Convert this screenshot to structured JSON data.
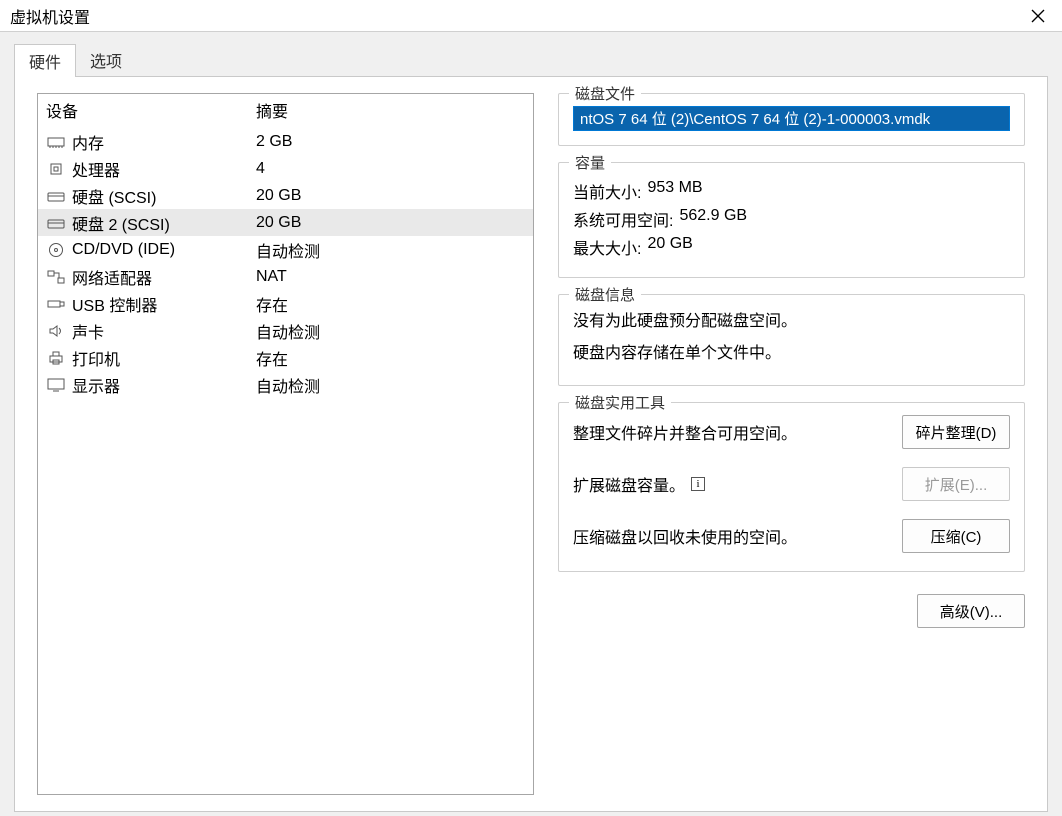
{
  "window": {
    "title": "虚拟机设置"
  },
  "tabs": {
    "hardware": "硬件",
    "options": "选项"
  },
  "device_table": {
    "header_device": "设备",
    "header_summary": "摘要",
    "rows": [
      {
        "icon": "memory-icon",
        "name": "内存",
        "summary": "2 GB"
      },
      {
        "icon": "cpu-icon",
        "name": "处理器",
        "summary": "4"
      },
      {
        "icon": "disk-icon",
        "name": "硬盘 (SCSI)",
        "summary": "20 GB"
      },
      {
        "icon": "disk-icon",
        "name": "硬盘 2 (SCSI)",
        "summary": "20 GB",
        "selected": true
      },
      {
        "icon": "cd-icon",
        "name": "CD/DVD (IDE)",
        "summary": "自动检测"
      },
      {
        "icon": "network-icon",
        "name": "网络适配器",
        "summary": "NAT"
      },
      {
        "icon": "usb-icon",
        "name": "USB 控制器",
        "summary": "存在"
      },
      {
        "icon": "audio-icon",
        "name": "声卡",
        "summary": "自动检测"
      },
      {
        "icon": "printer-icon",
        "name": "打印机",
        "summary": "存在"
      },
      {
        "icon": "display-icon",
        "name": "显示器",
        "summary": "自动检测"
      }
    ]
  },
  "disk_file": {
    "title": "磁盘文件",
    "value": "ntOS 7 64 位 (2)\\CentOS 7 64 位 (2)-1-000003.vmdk"
  },
  "capacity": {
    "title": "容量",
    "current_label": "当前大小:",
    "current_value": "953 MB",
    "free_label": "系统可用空间:",
    "free_value": "562.9 GB",
    "max_label": "最大大小:",
    "max_value": "20 GB"
  },
  "disk_info": {
    "title": "磁盘信息",
    "line1": "没有为此硬盘预分配磁盘空间。",
    "line2": "硬盘内容存储在单个文件中。"
  },
  "utilities": {
    "title": "磁盘实用工具",
    "defrag_text": "整理文件碎片并整合可用空间。",
    "defrag_btn": "碎片整理(D)",
    "expand_text": "扩展磁盘容量。",
    "expand_btn": "扩展(E)...",
    "compact_text": "压缩磁盘以回收未使用的空间。",
    "compact_btn": "压缩(C)"
  },
  "advanced_btn": "高级(V)..."
}
